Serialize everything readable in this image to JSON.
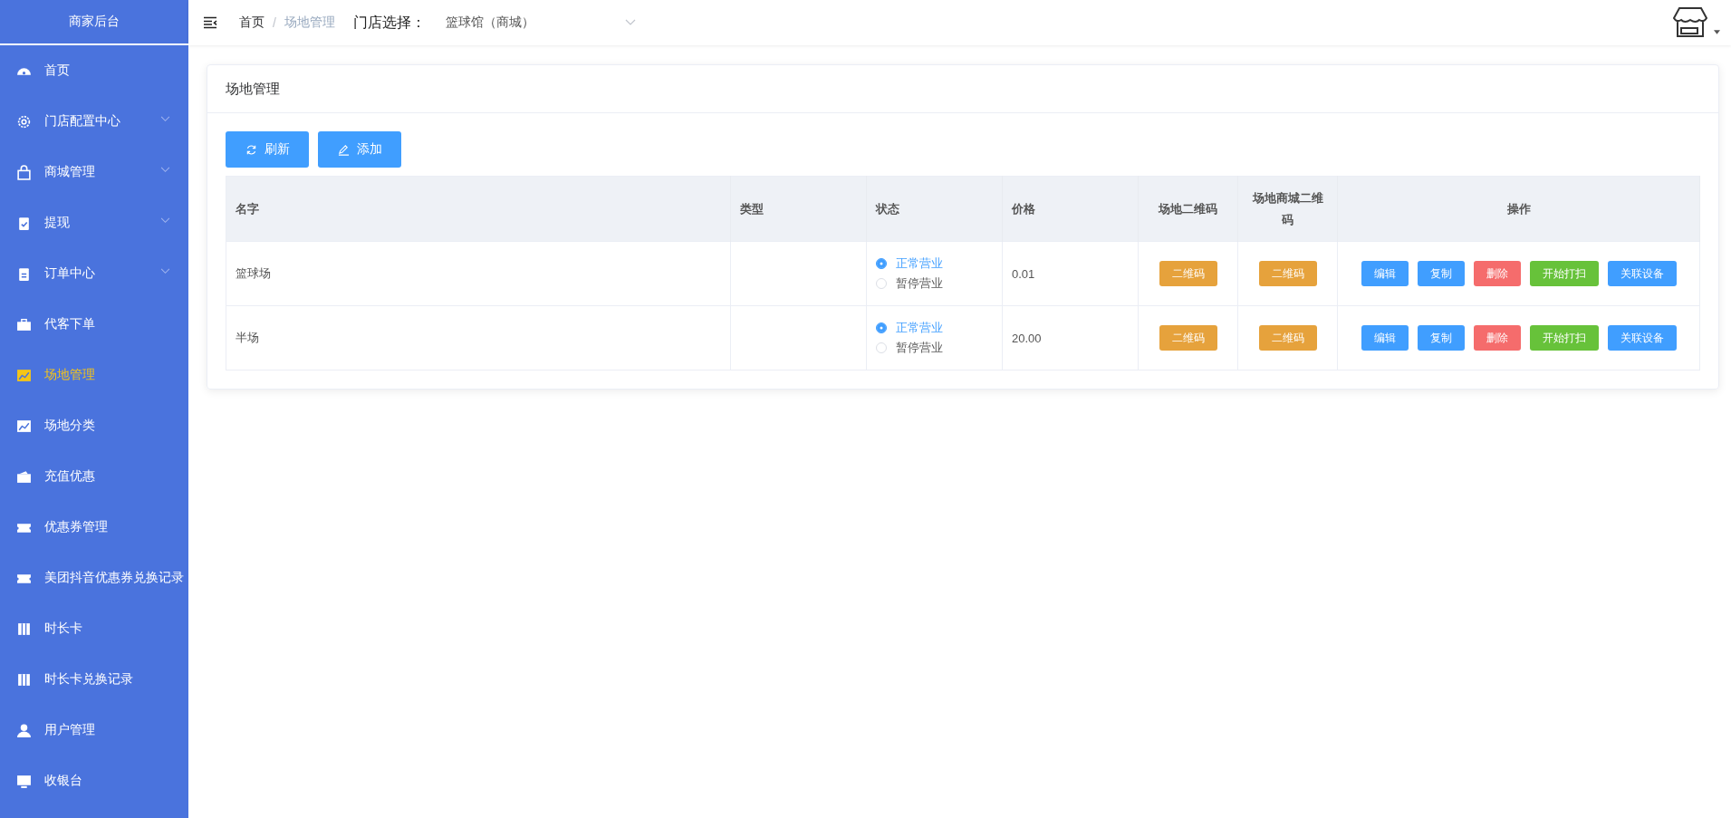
{
  "sidebar": {
    "title": "商家后台",
    "items": [
      {
        "label": "首页",
        "submenu": false,
        "selected": false
      },
      {
        "label": "门店配置中心",
        "submenu": true,
        "selected": false
      },
      {
        "label": "商城管理",
        "submenu": true,
        "selected": false
      },
      {
        "label": "提现",
        "submenu": true,
        "selected": false
      },
      {
        "label": "订单中心",
        "submenu": true,
        "selected": false
      },
      {
        "label": "代客下单",
        "submenu": false,
        "selected": false
      },
      {
        "label": "场地管理",
        "submenu": false,
        "selected": true
      },
      {
        "label": "场地分类",
        "submenu": false,
        "selected": false
      },
      {
        "label": "充值优惠",
        "submenu": false,
        "selected": false
      },
      {
        "label": "优惠券管理",
        "submenu": false,
        "selected": false
      },
      {
        "label": "美团抖音优惠券兑换记录",
        "submenu": false,
        "selected": false
      },
      {
        "label": "时长卡",
        "submenu": false,
        "selected": false
      },
      {
        "label": "时长卡兑换记录",
        "submenu": false,
        "selected": false
      },
      {
        "label": "用户管理",
        "submenu": false,
        "selected": false
      },
      {
        "label": "收银台",
        "submenu": false,
        "selected": false
      }
    ]
  },
  "breadcrumb": {
    "separator": "/",
    "items": [
      "首页",
      "场地管理"
    ]
  },
  "store_select": {
    "label": "门店选择：",
    "value": "篮球馆（商城）"
  },
  "card": {
    "title": "场地管理",
    "buttons": [
      "刷新",
      "添加"
    ]
  },
  "table": {
    "columns": [
      "名字",
      "类型",
      "状态",
      "价格",
      "场地二维码",
      "场地商城二维码",
      "操作"
    ],
    "rows": [
      {
        "name": "篮球场",
        "status": [
          {
            "label": "正常营业",
            "selected": true
          },
          {
            "label": "暂停营业",
            "selected": false
          }
        ],
        "price": "0.01",
        "qr": "二维码",
        "mall_qr": "二维码",
        "actions": [
          {
            "label": "编辑",
            "kind": "primary"
          },
          {
            "label": "复制",
            "kind": "primary"
          },
          {
            "label": "删除",
            "kind": "danger"
          },
          {
            "label": "开始打扫",
            "kind": "success"
          },
          {
            "label": "关联设备",
            "kind": "primary"
          }
        ]
      },
      {
        "name": "半场",
        "status": [
          {
            "label": "正常营业",
            "selected": true
          },
          {
            "label": "暂停营业",
            "selected": false
          }
        ],
        "price": "20.00",
        "qr": "二维码",
        "mall_qr": "二维码",
        "actions": [
          {
            "label": "编辑",
            "kind": "primary"
          },
          {
            "label": "复制",
            "kind": "primary"
          },
          {
            "label": "删除",
            "kind": "danger"
          },
          {
            "label": "开始打扫",
            "kind": "success"
          },
          {
            "label": "关联设备",
            "kind": "primary"
          }
        ]
      }
    ]
  }
}
